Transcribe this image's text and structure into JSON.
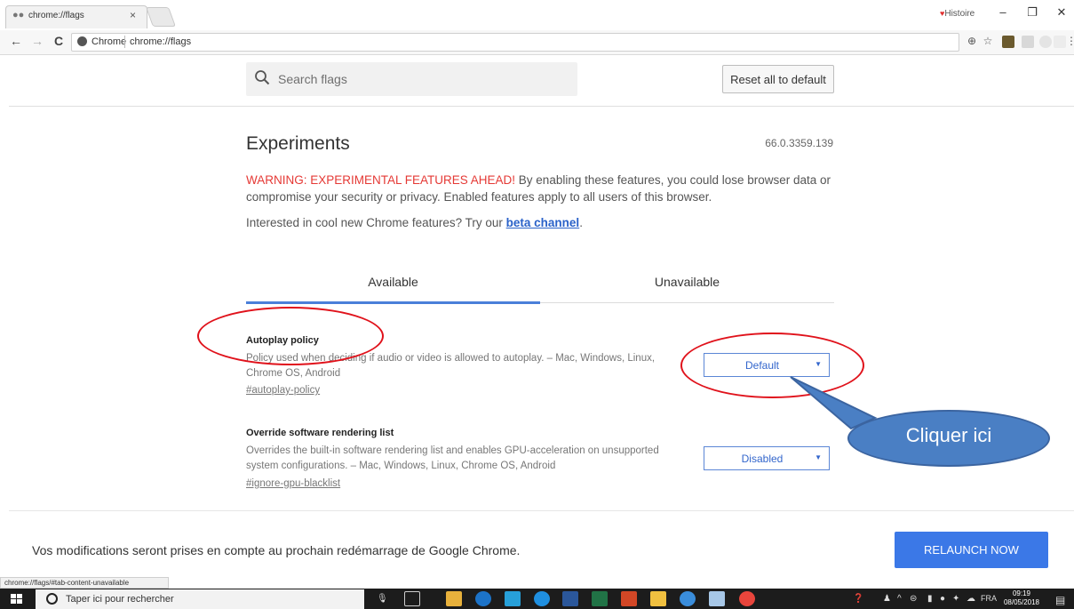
{
  "browser": {
    "tab_title": "chrome://flags",
    "tab_close": "×",
    "profile_label": "Histoire",
    "window_controls": {
      "minimize": "–",
      "restore": "❐",
      "close": "✕"
    },
    "nav": {
      "back": "←",
      "forward": "→",
      "reload": "C"
    },
    "site_chip": "Chrome",
    "url_text": "chrome://flags",
    "zoom_icon": "⊕",
    "bookmark_icon": "☆",
    "menu_icon": "⋮"
  },
  "flags_page": {
    "search_placeholder": "Search flags",
    "reset_button": "Reset all to default",
    "title": "Experiments",
    "version": "66.0.3359.139",
    "warning_strong": "WARNING: EXPERIMENTAL FEATURES AHEAD!",
    "warning_rest": " By enabling these features, you could lose browser data or compromise your security or privacy. Enabled features apply to all users of this browser.",
    "interest_prefix": "Interested in cool new Chrome features? Try our ",
    "beta_link": "beta channel",
    "interest_suffix": ".",
    "tabs": {
      "available": "Available",
      "unavailable": "Unavailable"
    },
    "flags": [
      {
        "name": "Autoplay policy",
        "description": "Policy used when deciding if audio or video is allowed to autoplay. – Mac, Windows, Linux, Chrome OS, Android",
        "link": "#autoplay-policy",
        "value": "Default"
      },
      {
        "name": "Override software rendering list",
        "description": "Overrides the built-in software rendering list and enables GPU-acceleration on unsupported system configurations. – Mac, Windows, Linux, Chrome OS, Android",
        "link": "#ignore-gpu-blacklist",
        "value": "Disabled"
      }
    ],
    "relaunch_message": "Vos modifications seront prises en compte au prochain redémarrage de Google Chrome.",
    "relaunch_button": "RELAUNCH NOW",
    "status_url": "chrome://flags/#tab-content-unavailable"
  },
  "annotation": {
    "callout_text": "Cliquer ici",
    "color": "#e0121b"
  },
  "taskbar": {
    "search_text": "Taper ici pour rechercher",
    "language": "FRA",
    "time": "09:19",
    "date": "08/05/2018"
  }
}
